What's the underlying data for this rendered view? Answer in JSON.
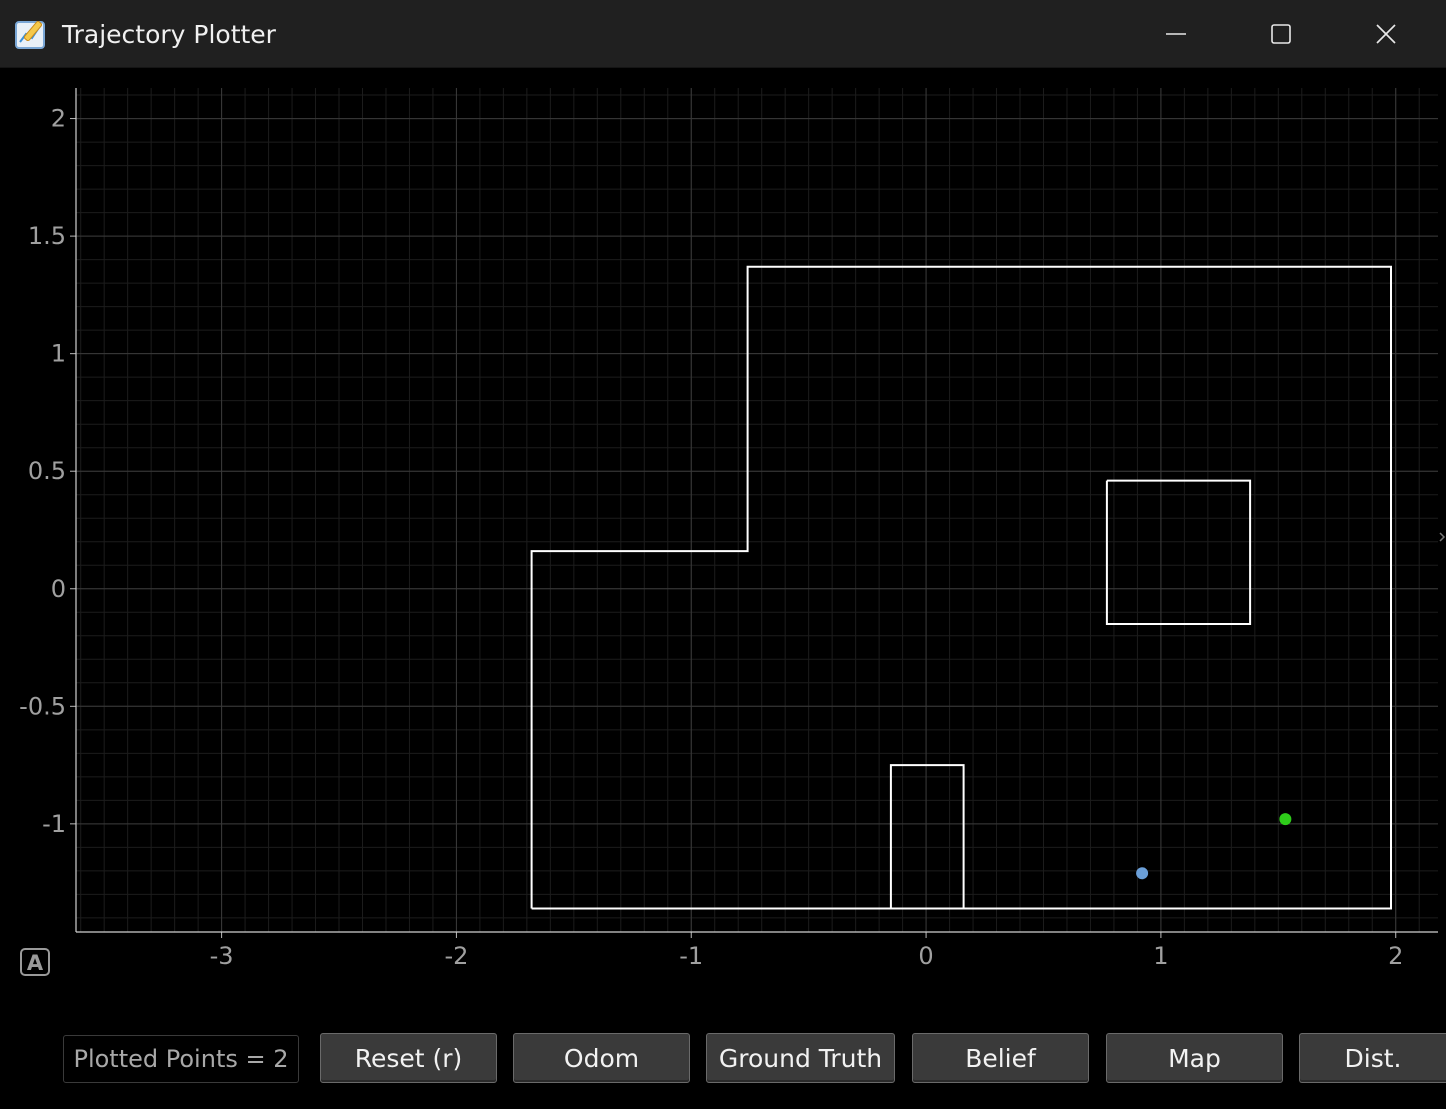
{
  "window": {
    "title": "Trajectory Plotter",
    "controls": [
      "minimize-icon",
      "maximize-icon",
      "close-icon"
    ]
  },
  "plot": {
    "background": "#000000",
    "grid_color": "#3a3a3a",
    "minor_grid_color": "#1c1c1c",
    "axis_color": "#ffffff",
    "tick_label_color": "#a0a0a0",
    "x_ticks": [
      "-3",
      "-2",
      "-1",
      "0",
      "1",
      "2"
    ],
    "y_ticks": [
      "2",
      "1.5",
      "1",
      "0.5",
      "0",
      "-0.5",
      "-1"
    ],
    "x_range": [
      -3.62,
      2.18
    ],
    "y_range": [
      -1.46,
      2.13
    ],
    "map_polygons": [
      [
        [
          -1.68,
          -1.36
        ],
        [
          -1.68,
          0.16
        ],
        [
          -0.76,
          0.16
        ],
        [
          -0.76,
          1.37
        ],
        [
          1.98,
          1.37
        ],
        [
          1.98,
          -1.36
        ],
        [
          -1.68,
          -1.36
        ]
      ],
      [
        [
          0.77,
          0.46
        ],
        [
          1.38,
          0.46
        ],
        [
          1.38,
          -0.15
        ],
        [
          0.77,
          -0.15
        ],
        [
          0.77,
          0.46
        ]
      ],
      [
        [
          -0.15,
          -1.36
        ],
        [
          -0.15,
          -0.75
        ],
        [
          0.16,
          -0.75
        ],
        [
          0.16,
          -1.36
        ]
      ]
    ],
    "points": [
      {
        "name": "ground-truth-point",
        "x": 1.53,
        "y": -0.98,
        "color": "#2ecc1a"
      },
      {
        "name": "odom-point",
        "x": 0.92,
        "y": -1.21,
        "color": "#6b9fd8"
      }
    ],
    "autoscale_label": "A"
  },
  "footer": {
    "status": "Plotted Points = 2",
    "buttons": [
      {
        "name": "reset-button",
        "label": "Reset (r)"
      },
      {
        "name": "odom-button",
        "label": "Odom"
      },
      {
        "name": "ground-truth-button",
        "label": "Ground Truth"
      },
      {
        "name": "belief-button",
        "label": "Belief"
      },
      {
        "name": "map-button",
        "label": "Map"
      },
      {
        "name": "dist-button",
        "label": "Dist."
      }
    ]
  }
}
